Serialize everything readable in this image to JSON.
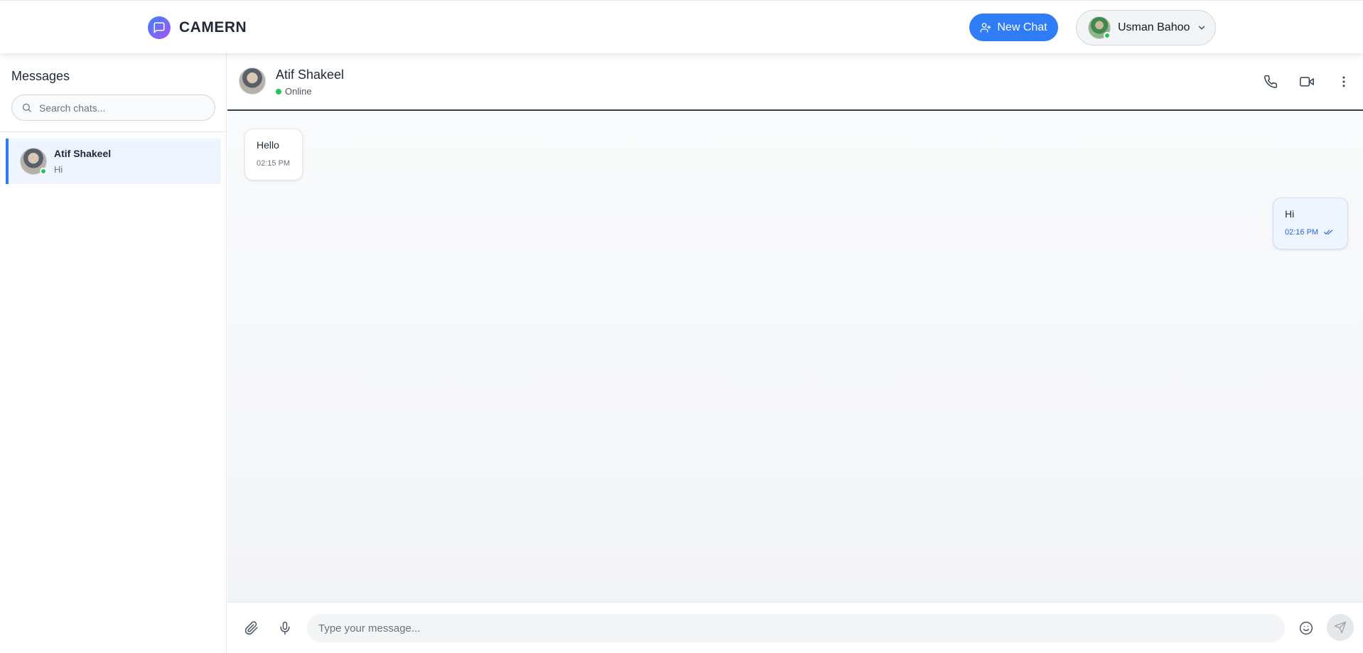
{
  "header": {
    "brand": "CAMERN",
    "new_chat_label": "New Chat",
    "user_name": "Usman Bahoo"
  },
  "sidebar": {
    "title": "Messages",
    "search_placeholder": "Search chats...",
    "chats": [
      {
        "name": "Atif Shakeel",
        "preview": "Hi",
        "online": true,
        "active": true
      }
    ]
  },
  "conversation": {
    "contact_name": "Atif Shakeel",
    "contact_status": "Online",
    "messages": [
      {
        "direction": "incoming",
        "text": "Hello",
        "time": "02:15 PM"
      },
      {
        "direction": "outgoing",
        "text": "Hi",
        "time": "02:16 PM",
        "read": true
      }
    ],
    "composer_placeholder": "Type your message..."
  },
  "icons": {
    "brand": "chat-bubble-icon",
    "new_chat": "user-plus-icon",
    "user_menu": "chevron-down-icon",
    "search": "search-icon",
    "call": "phone-icon",
    "video": "video-camera-icon",
    "more": "more-vertical-icon",
    "attach": "paperclip-icon",
    "mic": "microphone-icon",
    "emoji": "emoji-icon",
    "send": "send-icon",
    "read_receipt": "double-check-icon"
  },
  "colors": {
    "accent": "#2f7df6",
    "online": "#22c55e",
    "active_chat_bg": "#eef5ff",
    "brand_gradient_start": "#3b82f6",
    "brand_gradient_end": "#a855f7"
  }
}
